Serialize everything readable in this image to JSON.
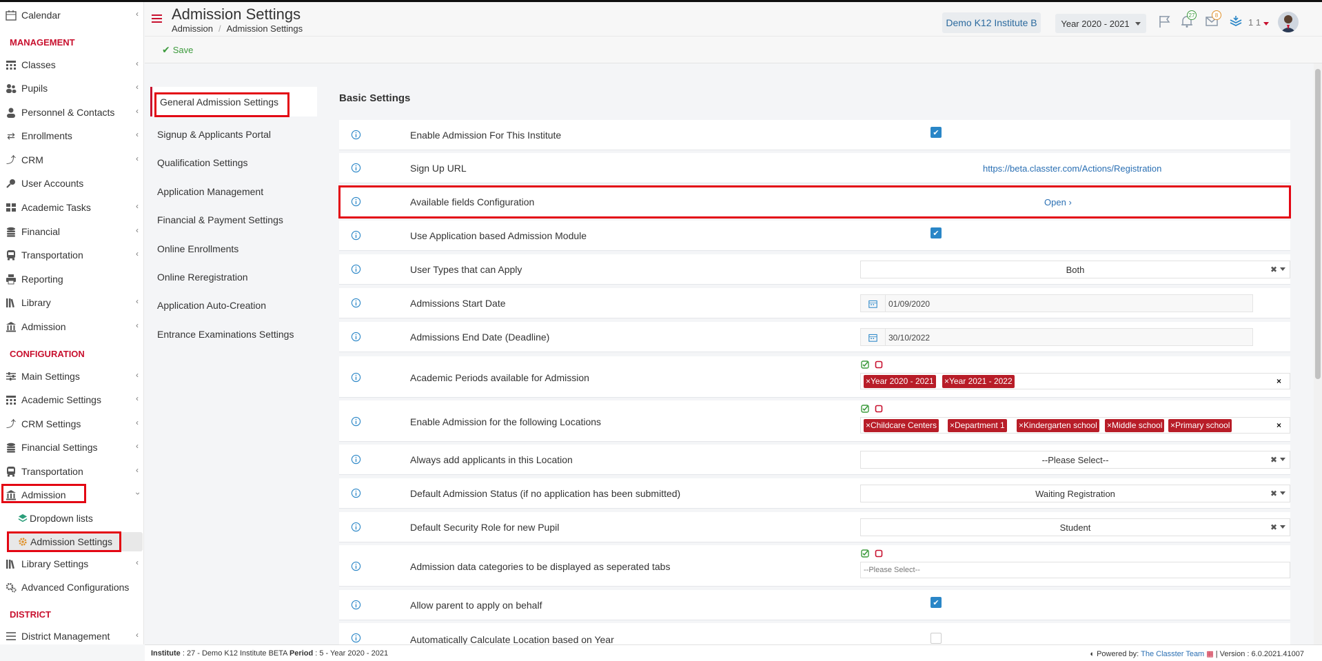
{
  "sidebar": {
    "items": [
      {
        "label": "Calendar",
        "icon": "calendar-icon"
      },
      {
        "label": "Classes",
        "icon": "classes-icon"
      },
      {
        "label": "Pupils",
        "icon": "pupils-icon"
      },
      {
        "label": "Personnel & Contacts",
        "icon": "person-icon"
      },
      {
        "label": "Enrollments",
        "icon": "arrows-icon"
      },
      {
        "label": "CRM",
        "icon": "crm-icon"
      },
      {
        "label": "User Accounts",
        "icon": "key-icon"
      },
      {
        "label": "Academic Tasks",
        "icon": "grid-icon"
      },
      {
        "label": "Financial",
        "icon": "coins-icon"
      },
      {
        "label": "Transportation",
        "icon": "bus-icon"
      },
      {
        "label": "Reporting",
        "icon": "printer-icon"
      },
      {
        "label": "Library",
        "icon": "books-icon"
      },
      {
        "label": "Admission",
        "icon": "bank-icon"
      },
      {
        "label": "Main Settings",
        "icon": "sliders-icon"
      },
      {
        "label": "Academic Settings",
        "icon": "classes-icon"
      },
      {
        "label": "CRM Settings",
        "icon": "crm-icon"
      },
      {
        "label": "Financial Settings",
        "icon": "coins-icon"
      },
      {
        "label": "Transportation",
        "icon": "bus-icon"
      },
      {
        "label": "Admission",
        "icon": "bank-icon"
      },
      {
        "label": "Dropdown lists",
        "icon": "layers-icon"
      },
      {
        "label": "Admission Settings",
        "icon": "gear-icon"
      },
      {
        "label": "Library Settings",
        "icon": "books-icon"
      },
      {
        "label": "Advanced Configurations",
        "icon": "gears-icon"
      },
      {
        "label": "District Management",
        "icon": "list-icon"
      }
    ],
    "headers": {
      "management": "MANAGEMENT",
      "configuration": "CONFIGURATION",
      "district": "DISTRICT"
    }
  },
  "header": {
    "title": "Admission Settings",
    "breadcrumb": [
      "Admission",
      "Admission Settings"
    ],
    "institute": "Demo K12 Institute B",
    "year": "Year 2020 - 2021",
    "notif_count": "27",
    "mail_count": "8",
    "user_num": "1 1"
  },
  "toolbar": {
    "save_label": "Save"
  },
  "subnav": [
    "General Admission Settings",
    "Signup & Applicants Portal",
    "Qualification Settings",
    "Application Management",
    "Financial & Payment Settings",
    "Online Enrollments",
    "Online Reregistration",
    "Application Auto-Creation",
    "Entrance Examinations Settings"
  ],
  "settings": {
    "section_title": "Basic Settings",
    "rows": [
      {
        "label": "Enable Admission For This Institute",
        "checked": true
      },
      {
        "label": "Sign Up URL",
        "value": "https://beta.classter.com/Actions/Registration"
      },
      {
        "label": "Available fields Configuration",
        "value": "Open"
      },
      {
        "label": "Use Application based Admission Module",
        "checked": true
      },
      {
        "label": "User Types that can Apply",
        "value": "Both"
      },
      {
        "label": "Admissions Start Date",
        "value": "01/09/2020"
      },
      {
        "label": "Admissions End Date (Deadline)",
        "value": "30/10/2022"
      },
      {
        "label": "Academic Periods available for Admission",
        "tags": [
          "Year 2020 - 2021",
          "Year 2021 - 2022"
        ]
      },
      {
        "label": "Enable Admission for the following Locations",
        "tags": [
          "Childcare Centers",
          "Department 1",
          "Kindergarten school",
          "Middle school",
          "Primary school"
        ]
      },
      {
        "label": "Always add applicants in this Location",
        "value": "--Please Select--"
      },
      {
        "label": "Default Admission Status (if no application has been submitted)",
        "value": "Waiting Registration"
      },
      {
        "label": "Default Security Role for new Pupil",
        "value": "Student"
      },
      {
        "label": "Admission data categories to be displayed as seperated tabs",
        "placeholder": "--Please Select--"
      },
      {
        "label": "Allow parent to apply on behalf",
        "checked": true
      },
      {
        "label": "Automatically Calculate Location based on Year",
        "checked": false
      }
    ]
  },
  "footer": {
    "institute_label": "Institute",
    "institute_value": ": 27 - Demo K12 Institute BETA",
    "period_label": "Period",
    "period_value": ": 5 - Year 2020 - 2021",
    "powered_label": "Powered by:",
    "powered_link": "The Classter Team",
    "version": "| Version : 6.0.2021.41007"
  },
  "colors": {
    "accent": "#c8102e",
    "link": "#2a6fb3",
    "check": "#2a86c7",
    "tag": "#b81d28",
    "highlight": "#e30613"
  }
}
